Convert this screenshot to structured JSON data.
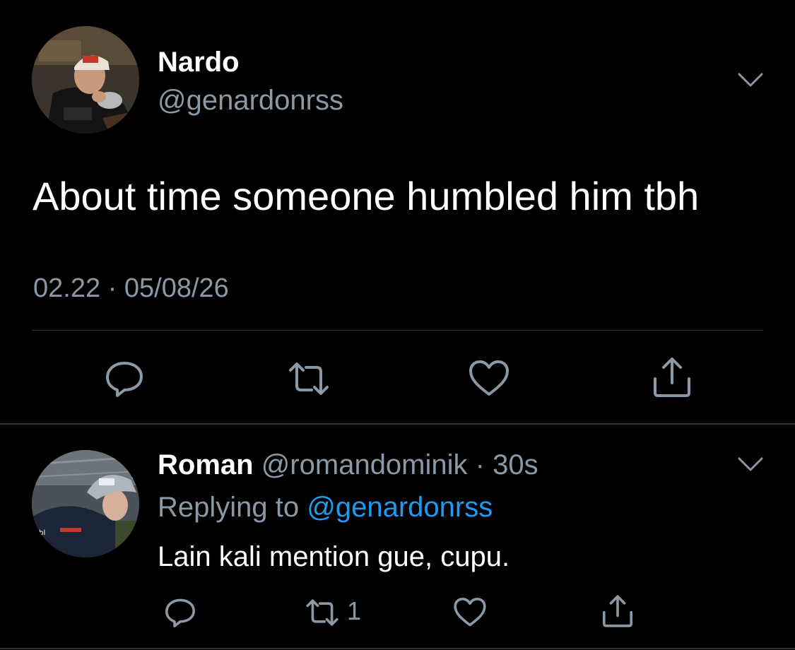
{
  "main_tweet": {
    "author_name": "Nardo",
    "author_handle": "@genardonrss",
    "text": "About time someone humbled him tbh",
    "timestamp": "02.22 · 05/08/26",
    "avatar_icon": "user-photo-avatar",
    "actions": [
      "reply-icon",
      "retweet-icon",
      "like-icon",
      "share-icon"
    ]
  },
  "reply_tweet": {
    "author_name": "Roman",
    "author_handle": "@romandominik",
    "separator": " · ",
    "time_ago": "30s",
    "replying_prefix": "Replying to ",
    "replying_mention": "@genardonrss",
    "text": "Lain kali mention gue, cupu.",
    "retweet_count": "1",
    "avatar_icon": "user-photo-avatar",
    "actions": [
      "reply-icon",
      "retweet-icon",
      "like-icon",
      "share-icon"
    ]
  },
  "colors": {
    "background": "#000000",
    "primary_text": "#ffffff",
    "secondary_text": "#8b98a5",
    "link": "#1d9bf0",
    "divider": "#2f3336"
  }
}
